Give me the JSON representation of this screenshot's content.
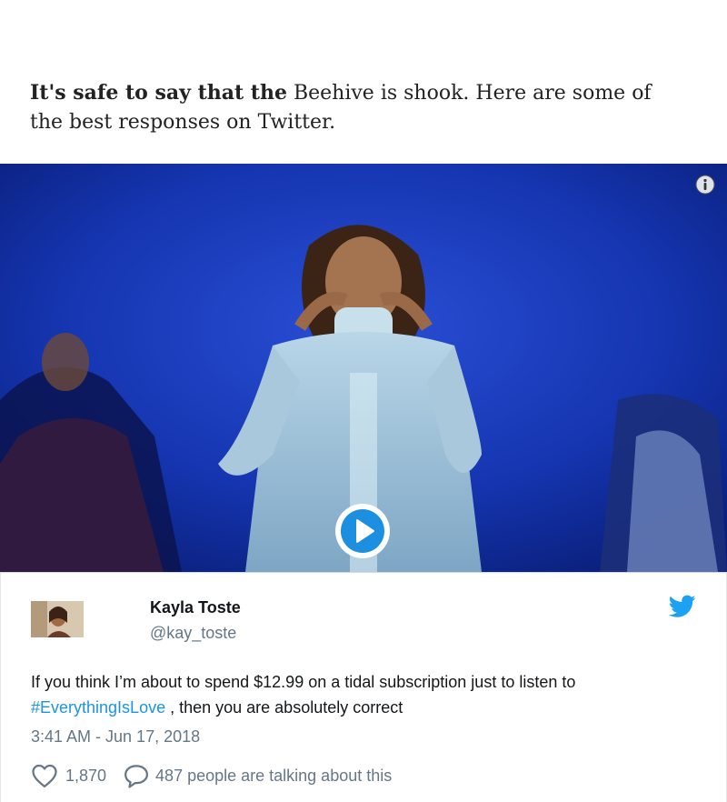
{
  "article": {
    "lead_bold": "It's safe  to say that the",
    "lead_rest": " Beehive is shook. Here  are some of the best responses on  Twitter."
  },
  "video": {
    "info_icon": "info-icon",
    "play_icon": "play-icon"
  },
  "tweet": {
    "author_name": "Kayla  Toste",
    "author_handle": "@kay_toste",
    "text_before": "If you think I’m about to spend $12.99 on a tidal subscription just to listen to ",
    "hashtag": "#EverythingIsLove",
    "text_after": "  , then you are absolutely correct",
    "timestamp": "3:41  AM - Jun 17, 2018",
    "likes": "1,870",
    "talking": "487 people  are  talking  about  this",
    "colors": {
      "link": "#1b95e0",
      "muted": "#657786",
      "brand": "#1da1f2"
    }
  }
}
